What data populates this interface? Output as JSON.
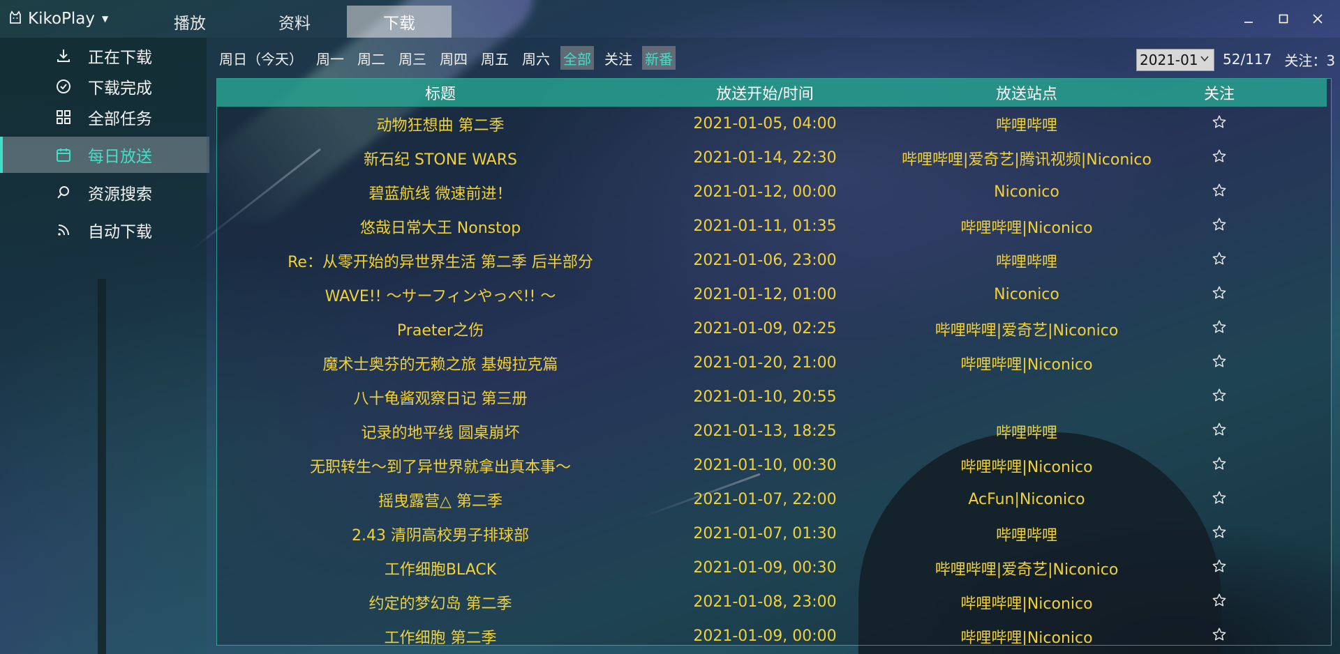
{
  "app": {
    "name": "KikoPlay",
    "tabs": [
      {
        "label": "播放",
        "active": false
      },
      {
        "label": "资料",
        "active": false
      },
      {
        "label": "下载",
        "active": true
      }
    ],
    "window_controls": [
      "minimize-icon",
      "maximize-icon",
      "close-icon"
    ]
  },
  "sidebar": {
    "items": [
      {
        "label": "正在下载",
        "icon": "download-icon",
        "active": false
      },
      {
        "label": "下载完成",
        "icon": "check-circle-icon",
        "active": false
      },
      {
        "label": "全部任务",
        "icon": "grid-icon",
        "active": false
      },
      {
        "label": "每日放送",
        "icon": "calendar-icon",
        "active": true
      },
      {
        "label": "资源搜索",
        "icon": "search-icon",
        "active": false
      },
      {
        "label": "自动下载",
        "icon": "rss-icon",
        "active": false
      }
    ]
  },
  "filters": {
    "days": [
      {
        "label": "周日（今天）",
        "selected": false
      },
      {
        "label": "周一",
        "selected": false
      },
      {
        "label": "周二",
        "selected": false
      },
      {
        "label": "周三",
        "selected": false
      },
      {
        "label": "周四",
        "selected": false
      },
      {
        "label": "周五",
        "selected": false
      },
      {
        "label": "周六",
        "selected": false
      },
      {
        "label": "全部",
        "selected": true
      },
      {
        "label": "关注",
        "selected": false
      },
      {
        "label": "新番",
        "selected": true
      }
    ],
    "month": "2021-01",
    "count": "52/117",
    "following": "关注：3"
  },
  "table": {
    "headers": {
      "title": "标题",
      "time": "放送开始/时间",
      "site": "放送站点",
      "follow": "关注"
    },
    "rows": [
      {
        "title": "动物狂想曲 第二季",
        "time": "2021-01-05, 04:00",
        "site": "哔哩哔哩"
      },
      {
        "title": "新石纪 STONE WARS",
        "time": "2021-01-14, 22:30",
        "site": "哔哩哔哩|爱奇艺|腾讯视频|Niconico"
      },
      {
        "title": "碧蓝航线 微速前进！",
        "time": "2021-01-12, 00:00",
        "site": "Niconico"
      },
      {
        "title": "悠哉日常大王 Nonstop",
        "time": "2021-01-11, 01:35",
        "site": "哔哩哔哩|Niconico"
      },
      {
        "title": "Re：从零开始的异世界生活 第二季 后半部分",
        "time": "2021-01-06, 23:00",
        "site": "哔哩哔哩"
      },
      {
        "title": "WAVE!! ～サーフィンやっぺ!! ～",
        "time": "2021-01-12, 01:00",
        "site": "Niconico"
      },
      {
        "title": "Praeter之伤",
        "time": "2021-01-09, 02:25",
        "site": "哔哩哔哩|爱奇艺|Niconico"
      },
      {
        "title": "魔术士奥芬的无赖之旅 基姆拉克篇",
        "time": "2021-01-20, 21:00",
        "site": "哔哩哔哩|Niconico"
      },
      {
        "title": "八十龟酱观察日记 第三册",
        "time": "2021-01-10, 20:55",
        "site": ""
      },
      {
        "title": "记录的地平线 圆桌崩坏",
        "time": "2021-01-13, 18:25",
        "site": "哔哩哔哩"
      },
      {
        "title": "无职转生～到了异世界就拿出真本事～",
        "time": "2021-01-10, 00:30",
        "site": "哔哩哔哩|Niconico"
      },
      {
        "title": "摇曳露营△ 第二季",
        "time": "2021-01-07, 22:00",
        "site": "AcFun|Niconico"
      },
      {
        "title": "2.43 清阴高校男子排球部",
        "time": "2021-01-07, 01:30",
        "site": "哔哩哔哩"
      },
      {
        "title": "工作细胞BLACK",
        "time": "2021-01-09, 00:30",
        "site": "哔哩哔哩|爱奇艺|Niconico"
      },
      {
        "title": "约定的梦幻岛 第二季",
        "time": "2021-01-08, 23:00",
        "site": "哔哩哔哩|Niconico"
      },
      {
        "title": "工作细胞 第二季",
        "time": "2021-01-09, 00:00",
        "site": "哔哩哔哩|Niconico"
      }
    ]
  },
  "colors": {
    "accent": "#3fe0c6",
    "row_text": "#f1d13a",
    "header_bg": "#2aa996"
  }
}
